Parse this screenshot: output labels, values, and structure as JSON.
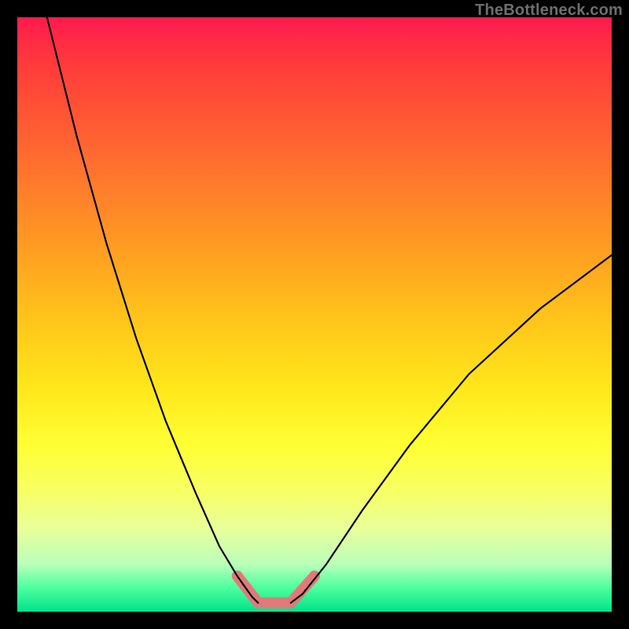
{
  "attribution": "TheBottleneck.com",
  "colors": {
    "gradient_top": "#ff1a4d",
    "gradient_bottom": "#00e28a",
    "curve": "#000000",
    "highlight": "#e07a7a",
    "frame_bg": "#000000",
    "attribution_text": "#6e6e6e"
  },
  "chart_data": {
    "type": "line",
    "title": "",
    "xlabel": "",
    "ylabel": "",
    "xlim": [
      0,
      100
    ],
    "ylim": [
      0,
      100
    ],
    "annotations": [],
    "series": [
      {
        "name": "left-branch",
        "x": [
          5,
          10,
          15,
          20,
          25,
          30,
          34,
          37,
          39.5,
          40.5
        ],
        "y": [
          100,
          80,
          62,
          46,
          32,
          20,
          11,
          6,
          2.5,
          1.5
        ]
      },
      {
        "name": "right-branch",
        "x": [
          46,
          48,
          52,
          58,
          66,
          76,
          88,
          100
        ],
        "y": [
          1.5,
          3,
          8,
          17,
          28,
          40,
          51,
          60
        ]
      },
      {
        "name": "valley-floor",
        "x": [
          40.5,
          43,
          46
        ],
        "y": [
          1.5,
          1.2,
          1.5
        ]
      }
    ],
    "highlight_region": {
      "description": "salmon overlay marking optimal (green) zone near bottom of V",
      "segments": [
        {
          "from": [
            37,
            6
          ],
          "to": [
            40.5,
            1.5
          ]
        },
        {
          "from": [
            40.5,
            1.5
          ],
          "to": [
            46,
            1.5
          ]
        },
        {
          "from": [
            46,
            1.5
          ],
          "to": [
            50,
            6
          ]
        }
      ]
    }
  }
}
